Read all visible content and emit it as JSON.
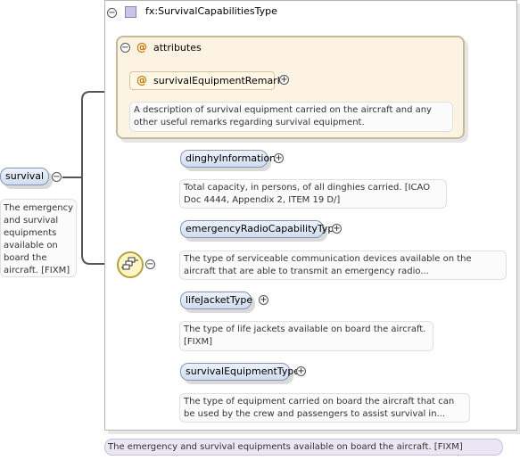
{
  "type": {
    "label": "fx:SurvivalCapabilitiesType"
  },
  "root": {
    "name": "survival",
    "description": "The emergency and survival equipments available on board the aircraft. [FIXM]"
  },
  "attributes": {
    "title": "attributes",
    "item": {
      "name": "survivalEquipmentRemarks",
      "description": "A description of survival equipment carried on the aircraft and any other useful remarks regarding survival equipment."
    }
  },
  "elements": [
    {
      "name": "dinghyInformation",
      "description": "Total capacity, in persons, of all dinghies carried. [ICAO Doc 4444, Appendix 2, ITEM 19 D/]"
    },
    {
      "name": "emergencyRadioCapabilityType",
      "description": "The type of serviceable communication devices available on the aircraft that are able to transmit an emergency radio..."
    },
    {
      "name": "lifeJacketType",
      "description": "The type of life jackets available on board the aircraft. [FIXM]"
    },
    {
      "name": "survivalEquipmentType",
      "description": "The type of equipment carried on board the aircraft that can be used by the crew and passengers to assist survival in..."
    }
  ],
  "footer": {
    "text": "The emergency and survival equipments available on board the aircraft. [FIXM]"
  },
  "colors": {
    "pill_border": "#8496b8",
    "attribute_bg": "#fdf3e3",
    "type_icon": "#cbc4e6",
    "sequence_bg": "#fff6c6"
  }
}
